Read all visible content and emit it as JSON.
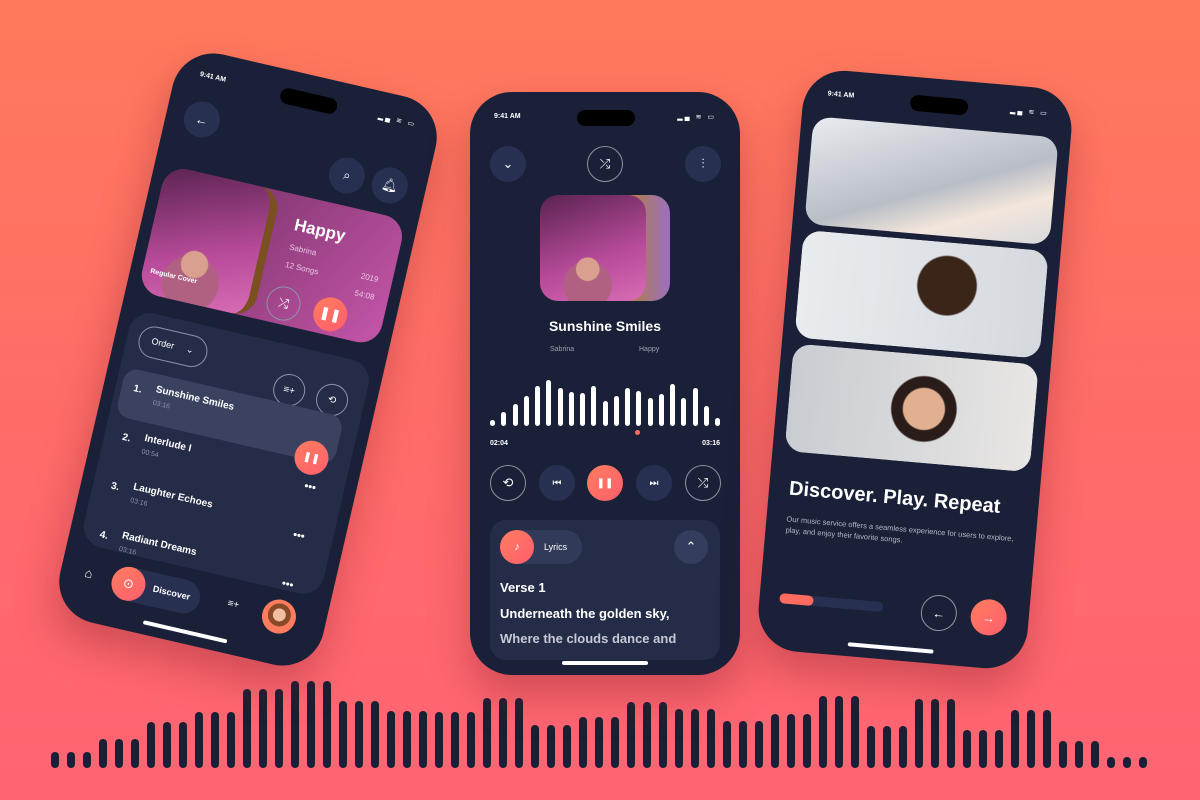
{
  "status_time": "9:41 AM",
  "colors": {
    "background": "#ff6a6a",
    "phone": "#1a2038",
    "card": "#252c48",
    "accent": "#ff6b66"
  },
  "background_wave": [
    16,
    29,
    46,
    56,
    79,
    87,
    67,
    57,
    56,
    70,
    43,
    51,
    66,
    59,
    47,
    54,
    72,
    42,
    69,
    38,
    58,
    27,
    11
  ],
  "album_screen": {
    "back_icon": "arrow-left-icon",
    "search_icon": "search-icon",
    "bell_icon": "bell-icon",
    "album": {
      "cover_label": "Regular Cover",
      "title": "Happy",
      "artist": "Sabrina",
      "year": "2019",
      "songs": "12 Songs",
      "duration": "54:08"
    },
    "order_label": "Order",
    "tracks": [
      {
        "num": "1.",
        "title": "Sunshine Smiles",
        "duration": "03:16",
        "playing": true
      },
      {
        "num": "2.",
        "title": "Interlude I",
        "duration": "00:54"
      },
      {
        "num": "3.",
        "title": "Laughter Echoes",
        "duration": "03:16"
      },
      {
        "num": "4.",
        "title": "Radiant Dreams",
        "duration": "03:16"
      }
    ],
    "nav": {
      "discover_label": "Discover"
    }
  },
  "player_screen": {
    "title": "Sunshine Smiles",
    "artist": "Sabrina",
    "album": "Happy",
    "elapsed": "02:04",
    "total": "03:16",
    "progress": 0.63,
    "wave": [
      6,
      14,
      22,
      30,
      40,
      46,
      38,
      34,
      33,
      40,
      25,
      30,
      38,
      35,
      28,
      32,
      42,
      28,
      38,
      20,
      8
    ],
    "lyrics_label": "Lyrics",
    "verse": "Verse 1",
    "lines": [
      "Underneath the golden sky,",
      "Where the clouds dance and"
    ]
  },
  "onboarding_screen": {
    "heading": "Discover. Play. Repeat",
    "description": "Our music service offers a seamless experience for users to explore, play, and enjoy their favorite songs.",
    "progress": 0.33
  }
}
